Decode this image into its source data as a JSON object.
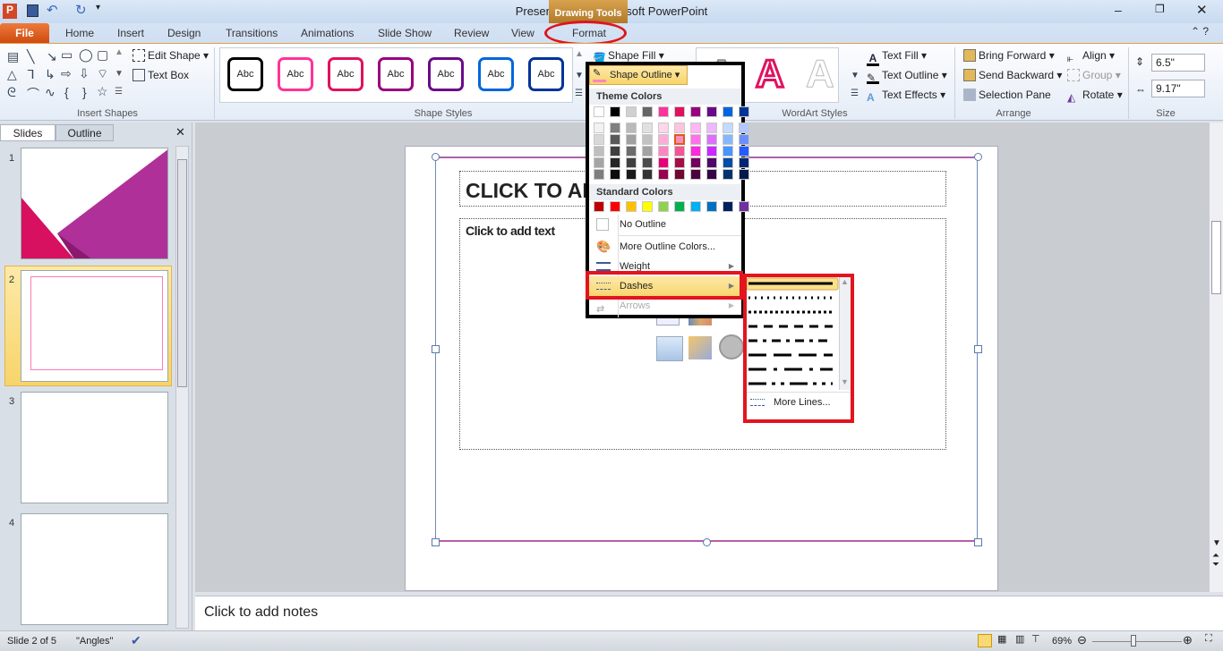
{
  "window": {
    "title": "Presentation1  -  Microsoft PowerPoint",
    "context_tab_group": "Drawing Tools",
    "app_icon": "powerpoint-icon"
  },
  "quick_access": [
    "save-icon",
    "undo-icon",
    "redo-icon",
    "customize-icon"
  ],
  "tabs": [
    "File",
    "Home",
    "Insert",
    "Design",
    "Transitions",
    "Animations",
    "Slide Show",
    "Review",
    "View",
    "Format"
  ],
  "active_tab": "Format",
  "ribbon": {
    "insert_shapes": {
      "label": "Insert Shapes",
      "edit_shape": "Edit Shape",
      "text_box": "Text Box"
    },
    "shape_styles": {
      "label": "Shape Styles",
      "sample": "Abc",
      "shape_fill": "Shape Fill",
      "shape_outline": "Shape Outline",
      "style_colors": [
        "#000000",
        "#ff3399",
        "#e0115f",
        "#990080",
        "#6a0a8a",
        "#0066dd",
        "#003399"
      ]
    },
    "wordart_styles": {
      "label": "WordArt Styles",
      "text_fill": "Text Fill",
      "text_outline": "Text Outline",
      "text_effects": "Text Effects",
      "sample": "A"
    },
    "arrange": {
      "label": "Arrange",
      "bring_forward": "Bring Forward",
      "send_backward": "Send Backward",
      "selection_pane": "Selection Pane",
      "align": "Align",
      "group": "Group",
      "rotate": "Rotate"
    },
    "size": {
      "label": "Size",
      "height": "6.5\"",
      "width": "9.17\""
    }
  },
  "left_pane": {
    "tabs": [
      "Slides",
      "Outline"
    ],
    "active": "Slides",
    "slides": [
      "1",
      "2",
      "3",
      "4"
    ],
    "selected": "2"
  },
  "slide": {
    "title_placeholder": "CLICK TO AD",
    "body_placeholder": "Click to add text",
    "outline_color": "#ff3399"
  },
  "notes": {
    "placeholder": "Click to add notes"
  },
  "outline_menu": {
    "theme_header": "Theme Colors",
    "theme_colors": [
      "#ffffff",
      "#000000",
      "#d0d0d0",
      "#666666",
      "#ff3399",
      "#e0115f",
      "#990080",
      "#6a0a8a",
      "#0066dd",
      "#003399"
    ],
    "theme_shades": [
      [
        "#f2f2f2",
        "#d8d8d8",
        "#bfbfbf",
        "#a5a5a5",
        "#7f7f7f"
      ],
      [
        "#7f7f7f",
        "#595959",
        "#3f3f3f",
        "#262626",
        "#0c0c0c"
      ],
      [
        "#bababa",
        "#a0a0a0",
        "#6c6c6c",
        "#404040",
        "#1a1a1a"
      ],
      [
        "#e0e0e0",
        "#c2c2c2",
        "#a3a3a3",
        "#4d4d4d",
        "#333333"
      ],
      [
        "#ffd6ea",
        "#ffadd6",
        "#ff85c2",
        "#e6007a",
        "#99004f"
      ],
      [
        "#fbc6dc",
        "#f78db8",
        "#f35595",
        "#a80c47",
        "#700830"
      ],
      [
        "#ffb8f5",
        "#ff70eb",
        "#ff29e0",
        "#73005f",
        "#4d0040"
      ],
      [
        "#edb8ff",
        "#dc70ff",
        "#ca29ff",
        "#4f0868",
        "#350545"
      ],
      [
        "#c2dcff",
        "#85b8ff",
        "#4795ff",
        "#004ca6",
        "#00336f"
      ],
      [
        "#b3c6ff",
        "#6b8fff",
        "#2659ff",
        "#002673",
        "#001a4d"
      ]
    ],
    "selected_shade": "#f78db8",
    "standard_header": "Standard Colors",
    "standard_colors": [
      "#c00000",
      "#ff0000",
      "#ffc000",
      "#ffff00",
      "#92d050",
      "#00b050",
      "#00b0f0",
      "#0070c0",
      "#002060",
      "#7030a0"
    ],
    "items": [
      {
        "label": "No Outline",
        "icon": "no-outline-icon"
      },
      {
        "label": "More Outline Colors...",
        "icon": "palette-icon"
      },
      {
        "label": "Weight",
        "icon": "weight-icon",
        "submenu": true
      },
      {
        "label": "Dashes",
        "icon": "dashes-icon",
        "submenu": true,
        "highlighted": true
      },
      {
        "label": "Arrows",
        "icon": "arrows-icon",
        "submenu": true,
        "disabled": true
      }
    ]
  },
  "dashes_menu": {
    "styles": [
      "solid",
      "round-dot",
      "square-dot",
      "dash",
      "dash-dot",
      "long-dash",
      "long-dash-dot",
      "long-dash-dot-dot"
    ],
    "selected": "solid",
    "more_lines": "More Lines..."
  },
  "status": {
    "slide": "Slide 2 of 5",
    "theme": "\"Angles\"",
    "zoom": "69%",
    "zoom_level_percent": 69
  }
}
